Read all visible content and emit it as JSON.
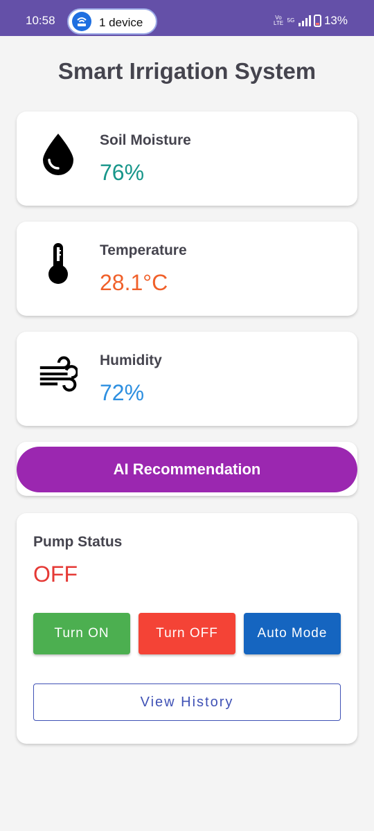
{
  "status_bar": {
    "time": "10:58",
    "device_chip_label": "1 device",
    "device_icon": "wifi-router-icon",
    "network_label_top": "Vo",
    "network_label_bottom": "LTE",
    "network_type": "5G",
    "battery_percent": "13%"
  },
  "page": {
    "title": "Smart Irrigation System"
  },
  "sensors": [
    {
      "label": "Soil Moisture",
      "value": "76%",
      "icon": "water-drop-icon",
      "value_color": "#17968a"
    },
    {
      "label": "Temperature",
      "value": "28.1°C",
      "icon": "thermometer-icon",
      "value_color": "#f0602a"
    },
    {
      "label": "Humidity",
      "value": "72%",
      "icon": "air-wind-icon",
      "value_color": "#2d8fe0"
    }
  ],
  "ai": {
    "button_label": "AI Recommendation",
    "color": "#9b27b0"
  },
  "pump": {
    "label": "Pump Status",
    "value": "OFF",
    "value_color": "#e53935",
    "turn_on_label": "Turn ON",
    "turn_off_label": "Turn OFF",
    "auto_mode_label": "Auto Mode",
    "history_label": "View History"
  }
}
